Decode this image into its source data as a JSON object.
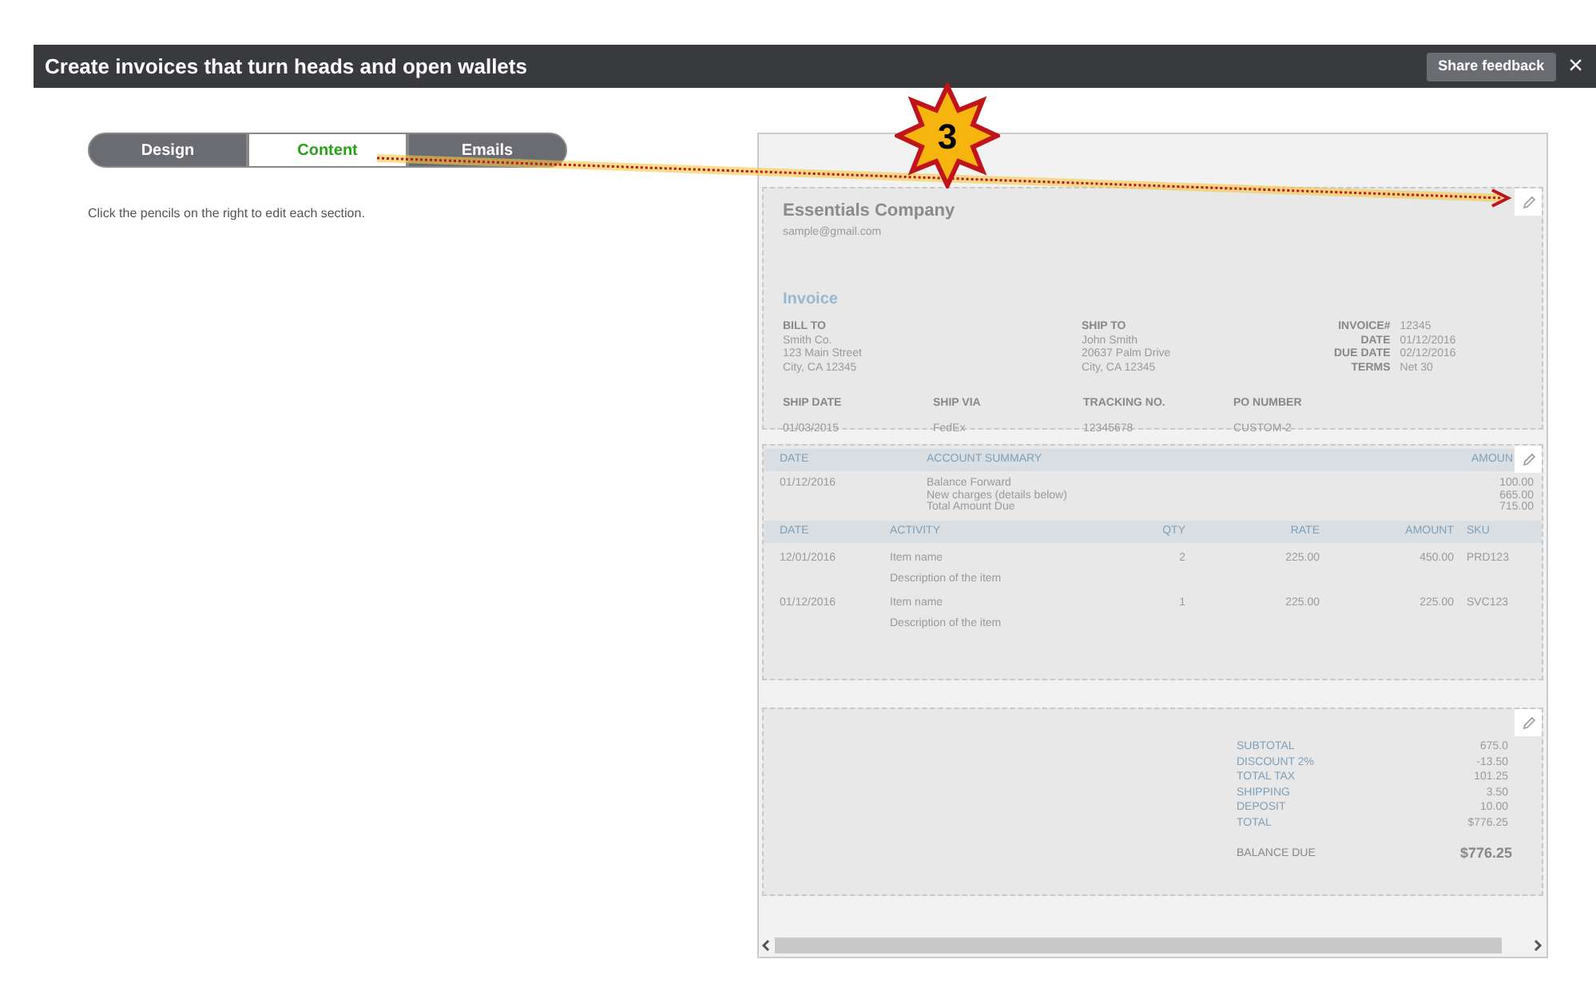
{
  "header": {
    "title": "Create invoices that turn heads and open wallets",
    "feedback_button": "Share feedback",
    "close": "×"
  },
  "tabs": [
    {
      "label": "Design",
      "selected": false
    },
    {
      "label": "Content",
      "selected": true
    },
    {
      "label": "Emails",
      "selected": false
    }
  ],
  "hint": "Click the pencils on the right to edit each section.",
  "annotation": {
    "step": "3"
  },
  "invoice": {
    "company": "Essentials Company",
    "email": "sample@gmail.com",
    "doc_title": "Invoice",
    "bill_to": {
      "label": "BILL TO",
      "lines": [
        "Smith Co.",
        "123 Main Street",
        "City, CA 12345"
      ]
    },
    "ship_to": {
      "label": "SHIP TO",
      "lines": [
        "John Smith",
        "20637 Palm Drive",
        "City, CA 12345"
      ]
    },
    "meta": [
      {
        "label": "INVOICE#",
        "value": "12345"
      },
      {
        "label": "DATE",
        "value": "01/12/2016"
      },
      {
        "label": "DUE DATE",
        "value": "02/12/2016"
      },
      {
        "label": "TERMS",
        "value": "Net 30"
      }
    ],
    "shipping": [
      {
        "label": "SHIP DATE",
        "value": "01/03/2015"
      },
      {
        "label": "SHIP VIA",
        "value": "FedEx"
      },
      {
        "label": "TRACKING NO.",
        "value": "12345678"
      },
      {
        "label": "PO NUMBER",
        "value": "CUSTOM-2"
      }
    ],
    "summary_columns": [
      "DATE",
      "ACCOUNT SUMMARY",
      "AMOUN"
    ],
    "summary": {
      "date": "01/12/2016",
      "lines": [
        "Balance Forward",
        "New charges (details below)",
        "Total Amount Due"
      ],
      "amounts": [
        "100.00",
        "665.00",
        "715.00"
      ]
    },
    "item_columns": [
      "DATE",
      "ACTIVITY",
      "QTY",
      "RATE",
      "AMOUNT",
      "SKU"
    ],
    "items": [
      {
        "date": "12/01/2016",
        "name": "Item name",
        "description": "Description of the item",
        "qty": "2",
        "rate": "225.00",
        "amount": "450.00",
        "sku": "PRD123"
      },
      {
        "date": "01/12/2016",
        "name": "Item name",
        "description": "Description of the item",
        "qty": "1",
        "rate": "225.00",
        "amount": "225.00",
        "sku": "SVC123"
      }
    ],
    "totals": [
      {
        "label": "SUBTOTAL",
        "value": "675.0"
      },
      {
        "label": "DISCOUNT 2%",
        "value": "-13.50"
      },
      {
        "label": "TOTAL TAX",
        "value": "101.25"
      },
      {
        "label": "SHIPPING",
        "value": "3.50"
      },
      {
        "label": "DEPOSIT",
        "value": "10.00"
      },
      {
        "label": "TOTAL",
        "value": "$776.25"
      }
    ],
    "balance_due": {
      "label": "BALANCE DUE",
      "value": "$776.25"
    }
  }
}
